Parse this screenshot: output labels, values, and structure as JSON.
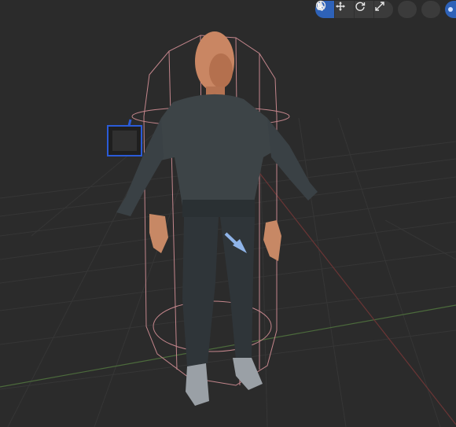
{
  "viewport": {
    "background": "#2b2b2b",
    "grid_color": "#3a3a3a",
    "axis_x_color": "#8a3a3a",
    "axis_y_color": "#4a6a3a",
    "collider_color": "#c98a8f",
    "light_color": "#2a5bd8"
  },
  "toolbar": {
    "tools": [
      {
        "icon": "select-cursor-icon",
        "active": true
      },
      {
        "icon": "move-icon",
        "active": false
      },
      {
        "icon": "rotate-icon",
        "active": false
      },
      {
        "icon": "scale-icon",
        "active": false
      }
    ],
    "extra": [
      {
        "icon": "camera-gizmo-icon"
      },
      {
        "icon": "transform-gizmo-icon"
      },
      {
        "icon": "local-space-toggle-icon",
        "active": true
      }
    ]
  },
  "character": {
    "skin_color": "#d08f67",
    "shirt_color": "#3d4447",
    "pants_color": "#2f3539",
    "shoe_color": "#9aa0a6"
  }
}
